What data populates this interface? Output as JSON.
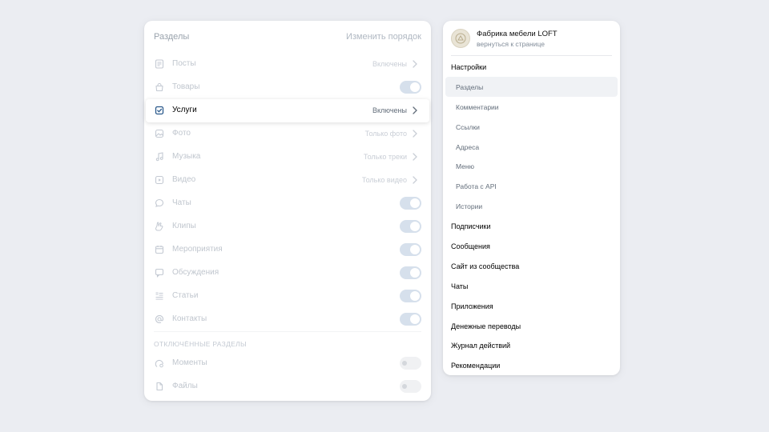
{
  "sections_panel": {
    "title": "Разделы",
    "reorder_link": "Изменить порядок",
    "items": [
      {
        "icon": "posts-icon",
        "label": "Посты",
        "value": "Включены",
        "control": "chevron"
      },
      {
        "icon": "goods-icon",
        "label": "Товары",
        "value": "",
        "control": "toggle-on"
      },
      {
        "icon": "services-icon",
        "label": "Услуги",
        "value": "Включены",
        "control": "chevron",
        "active": true
      },
      {
        "icon": "photo-icon",
        "label": "Фото",
        "value": "Только фото",
        "control": "chevron"
      },
      {
        "icon": "music-icon",
        "label": "Музыка",
        "value": "Только треки",
        "control": "chevron"
      },
      {
        "icon": "video-icon",
        "label": "Видео",
        "value": "Только видео",
        "control": "chevron"
      },
      {
        "icon": "chat-icon",
        "label": "Чаты",
        "value": "",
        "control": "toggle-on"
      },
      {
        "icon": "clips-icon",
        "label": "Клипы",
        "value": "",
        "control": "toggle-on"
      },
      {
        "icon": "events-icon",
        "label": "Мероприятия",
        "value": "",
        "control": "toggle-on"
      },
      {
        "icon": "discussions-icon",
        "label": "Обсуждения",
        "value": "",
        "control": "toggle-on"
      },
      {
        "icon": "articles-icon",
        "label": "Статьи",
        "value": "",
        "control": "toggle-on"
      },
      {
        "icon": "contacts-icon",
        "label": "Контакты",
        "value": "",
        "control": "toggle-on"
      }
    ],
    "disabled_title": "ОТКЛЮЧЁННЫЕ РАЗДЕЛЫ",
    "disabled_items": [
      {
        "icon": "moments-icon",
        "label": "Моменты",
        "control": "toggle-off"
      },
      {
        "icon": "files-icon",
        "label": "Файлы",
        "control": "toggle-off"
      }
    ]
  },
  "settings_menu": {
    "community_name": "Фабрика мебели LOFT",
    "back_link": "вернуться к странице",
    "items": [
      {
        "label": "Настройки",
        "level": "top"
      },
      {
        "label": "Разделы",
        "level": "sub",
        "selected": true
      },
      {
        "label": "Комментарии",
        "level": "sub"
      },
      {
        "label": "Ссылки",
        "level": "sub"
      },
      {
        "label": "Адреса",
        "level": "sub"
      },
      {
        "label": "Меню",
        "level": "sub"
      },
      {
        "label": "Работа с API",
        "level": "sub"
      },
      {
        "label": "Истории",
        "level": "sub"
      },
      {
        "label": "Подписчики",
        "level": "top"
      },
      {
        "label": "Сообщения",
        "level": "top"
      },
      {
        "label": "Сайт из сообщества",
        "level": "top"
      },
      {
        "label": "Чаты",
        "level": "top"
      },
      {
        "label": "Приложения",
        "level": "top"
      },
      {
        "label": "Денежные переводы",
        "level": "top"
      },
      {
        "label": "Журнал действий",
        "level": "top"
      },
      {
        "label": "Рекомендации",
        "level": "top"
      }
    ]
  },
  "colors": {
    "background": "#ebedf2",
    "accent": "#2b5a8c",
    "toggle_on": "#d6e0ec"
  }
}
